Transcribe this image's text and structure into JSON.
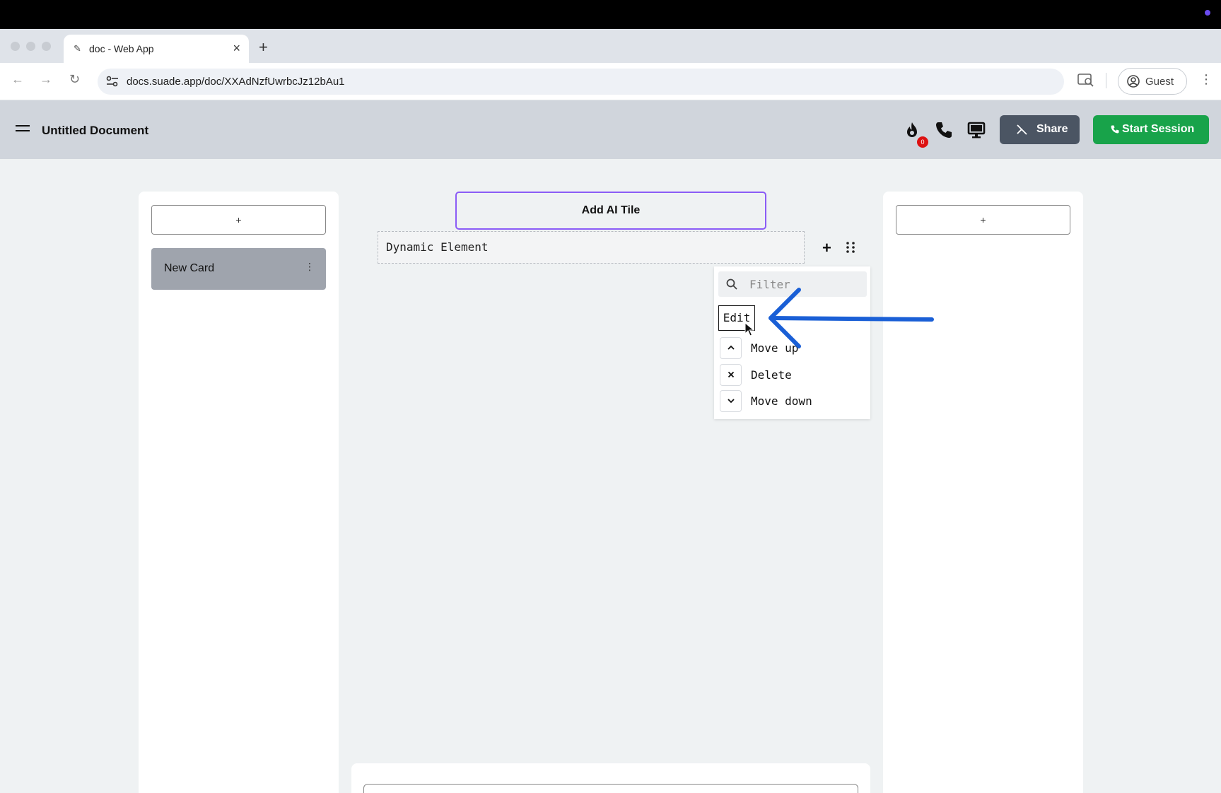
{
  "browser": {
    "tab_title": "doc - Web App",
    "url": "docs.suade.app/doc/XXAdNzfUwrbcJz12bAu1",
    "profile_label": "Guest"
  },
  "header": {
    "doc_title": "Untitled Document",
    "notification_count": "0",
    "share_label": "Share",
    "start_session_label": "Start Session"
  },
  "left_panel": {
    "add_label": "+",
    "cards": [
      {
        "title": "New Card",
        "menu": "⋮"
      }
    ]
  },
  "right_panel": {
    "add_label": "+"
  },
  "center": {
    "ai_tile_label": "Add AI Tile",
    "dynamic_element_label": "Dynamic Element",
    "add_element_label": "+"
  },
  "context_menu": {
    "filter_placeholder": "Filter",
    "items": [
      {
        "label": "Edit",
        "icon": ""
      },
      {
        "label": "Move up",
        "icon": "chevron-up-icon"
      },
      {
        "label": "Delete",
        "icon": "close-icon"
      },
      {
        "label": "Move down",
        "icon": "chevron-down-icon"
      }
    ]
  },
  "colors": {
    "accent_purple": "#8b5cf6",
    "start_session_green": "#18a34a",
    "share_gray": "#4b5563",
    "annotation_arrow": "#1a5fd6",
    "badge_red": "#dd1111"
  }
}
